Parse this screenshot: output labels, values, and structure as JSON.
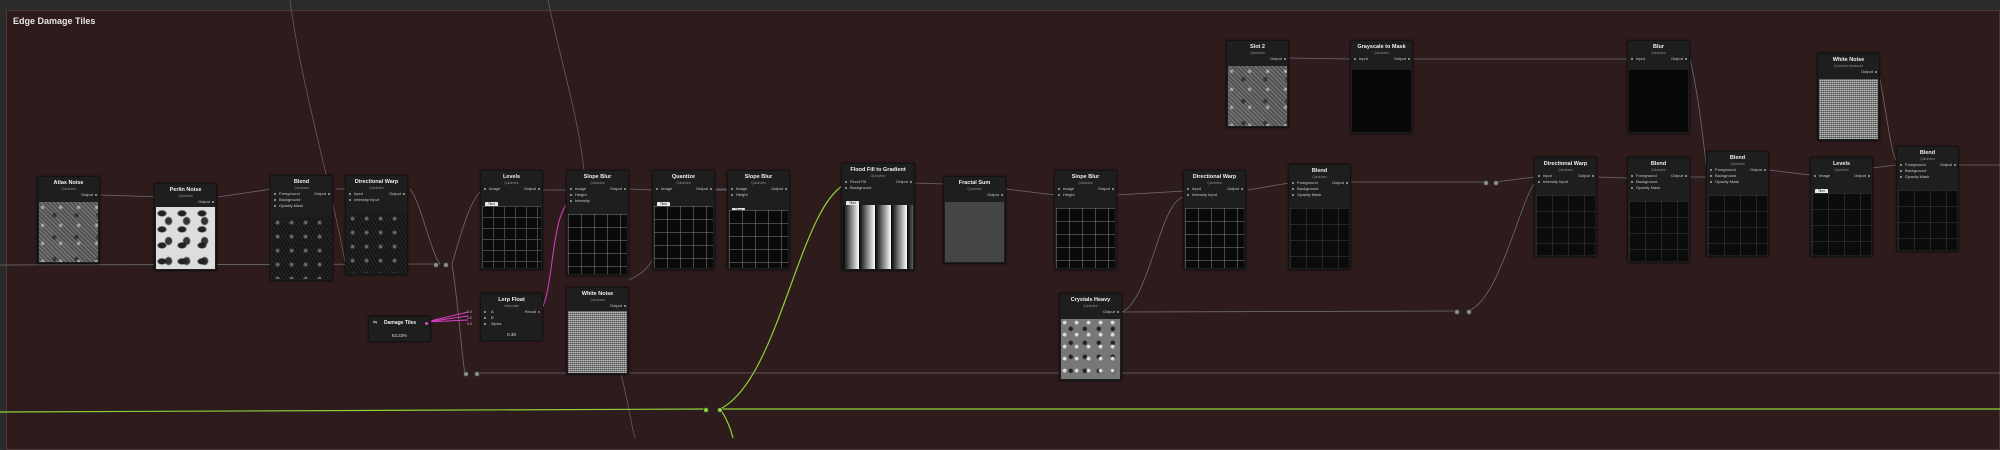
{
  "frame": {
    "title": "Edge Damage Tiles"
  },
  "common": {
    "subtitle": "Quickview",
    "output": "Output",
    "badge": "Tiled"
  },
  "nodes": {
    "atlas_noise": {
      "title": "Atlas Noise"
    },
    "perlin_noise": {
      "title": "Perlin Noise"
    },
    "blend1": {
      "title": "Blend",
      "ports": [
        "Foreground",
        "Background",
        "Opacity Mask"
      ]
    },
    "directional_warp1": {
      "title": "Directional Warp",
      "ports": [
        "Input",
        "Intensity Input"
      ]
    },
    "levels1": {
      "title": "Levels",
      "ports": [
        "Image"
      ]
    },
    "slope_blur1": {
      "title": "Slope Blur",
      "ports": [
        "Image",
        "Height",
        "Intensity"
      ]
    },
    "quantize": {
      "title": "Quantize",
      "ports": [
        "Image"
      ]
    },
    "slope_blur2": {
      "title": "Slope Blur",
      "ports": [
        "Image",
        "Height"
      ]
    },
    "flood_fill": {
      "title": "Flood Fill to Gradient",
      "ports": [
        "Flood Fill",
        "Background"
      ]
    },
    "fractal_sum": {
      "title": "Fractal Sum"
    },
    "slope_blur3": {
      "title": "Slope Blur",
      "ports": [
        "Image",
        "Height"
      ]
    },
    "directional_warp2": {
      "title": "Directional Warp",
      "ports": [
        "Input",
        "Intensity Input"
      ]
    },
    "blend2": {
      "title": "Blend",
      "ports": [
        "Foreground",
        "Background",
        "Opacity Mask"
      ]
    },
    "directional_warp3": {
      "title": "Directional Warp",
      "ports": [
        "Input",
        "Intensity Input"
      ]
    },
    "blend3": {
      "title": "Blend",
      "ports": [
        "Foreground",
        "Background",
        "Opacity Mask"
      ]
    },
    "blend4": {
      "title": "Blend",
      "ports": [
        "Foreground",
        "Background",
        "Opacity Mask"
      ]
    },
    "levels2": {
      "title": "Levels",
      "ports": [
        "Image"
      ]
    },
    "blend5": {
      "title": "Blend",
      "ports": [
        "Foreground",
        "Background",
        "Opacity Mask"
      ]
    },
    "slot2": {
      "title": "Slot 2"
    },
    "grayscale_mask": {
      "title": "Grayscale to Mask",
      "ports": [
        "Input"
      ]
    },
    "blur": {
      "title": "Blur",
      "ports": [
        "Input"
      ]
    },
    "white_noise_top": {
      "title": "White Noise",
      "subtitle": "Quickview Advanced"
    },
    "white_noise_mid": {
      "title": "White Noise"
    },
    "crystals_heavy": {
      "title": "Crystals Heavy"
    },
    "lerp_float": {
      "title": "Lerp Float",
      "subtitle": "Interpolate",
      "inputs": [
        "A",
        "B",
        "Alpha"
      ],
      "input_tags": [
        "0.0",
        "1.0",
        "0.5"
      ],
      "output": "Result",
      "value": "0.38"
    },
    "damage_tiles": {
      "label": "Damage Tiles",
      "value": "63.33%"
    }
  },
  "colors": {
    "frame_bg": "#2e1b1c",
    "wire_gray": "#6c6c6c",
    "wire_green": "#8bd23a",
    "wire_pink": "#d63fc6"
  }
}
